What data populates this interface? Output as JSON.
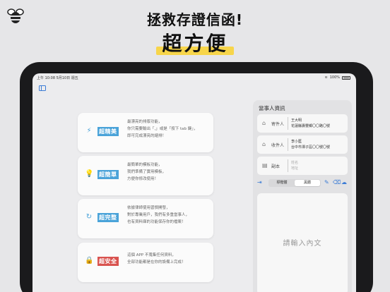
{
  "header": {
    "headline": "拯救存證信函!",
    "subheadline": "超方便"
  },
  "status_bar": {
    "time_date": "上午 10:08   5月10日 週五",
    "battery": "100%"
  },
  "features": [
    {
      "badge": "超精美",
      "badge_color": "#4aa3d9",
      "icon": "magic-wand-icon",
      "icon_glyph": "⚡",
      "icon_color": "#4aa3d9",
      "lines": [
        "最漂亮的排版功能，",
        "你只需要輸出「,」或是「按下 tab 鍵」，",
        "即可完成漂亮的縮排！"
      ]
    },
    {
      "badge": "超簡單",
      "badge_color": "#4aa3d9",
      "icon": "lightbulb-icon",
      "icon_glyph": "💡",
      "icon_color": "#f0c020",
      "lines": [
        "最簡單的模板功能，",
        "我們準備了實用模板，",
        "方便你修改使用！"
      ]
    },
    {
      "badge": "超完整",
      "badge_color": "#4aa3d9",
      "icon": "refresh-icon",
      "icon_glyph": "↻",
      "icon_color": "#4aa3d9",
      "lines": [
        "依據律師使用習慣開發，",
        "對於專業用戶，我們有多重當事人，",
        "也有資料庫的功能保存你的檔案！"
      ]
    },
    {
      "badge": "超安全",
      "badge_color": "#d9534f",
      "icon": "lock-icon",
      "icon_glyph": "🔒",
      "icon_color": "#d9534f",
      "lines": [
        "這個 APP 不蒐集任何資料，",
        "全部功能都是在你的設備上完成！"
      ]
    }
  ],
  "panel": {
    "title": "當事人資訊",
    "sender": {
      "label": "寄件人",
      "name": "王大明",
      "address": "花蓮縣壽豐鄉〇〇路〇號"
    },
    "recipient": {
      "label": "收件人",
      "name": "李小藍",
      "address": "台中市潭子區〇〇號〇號"
    },
    "cc": {
      "label": "副本",
      "name_placeholder": "姓名",
      "address_placeholder": "地址"
    },
    "segments": [
      "標楷體",
      "黑體"
    ],
    "active_segment": 1,
    "content_placeholder": "請輸入內文"
  }
}
